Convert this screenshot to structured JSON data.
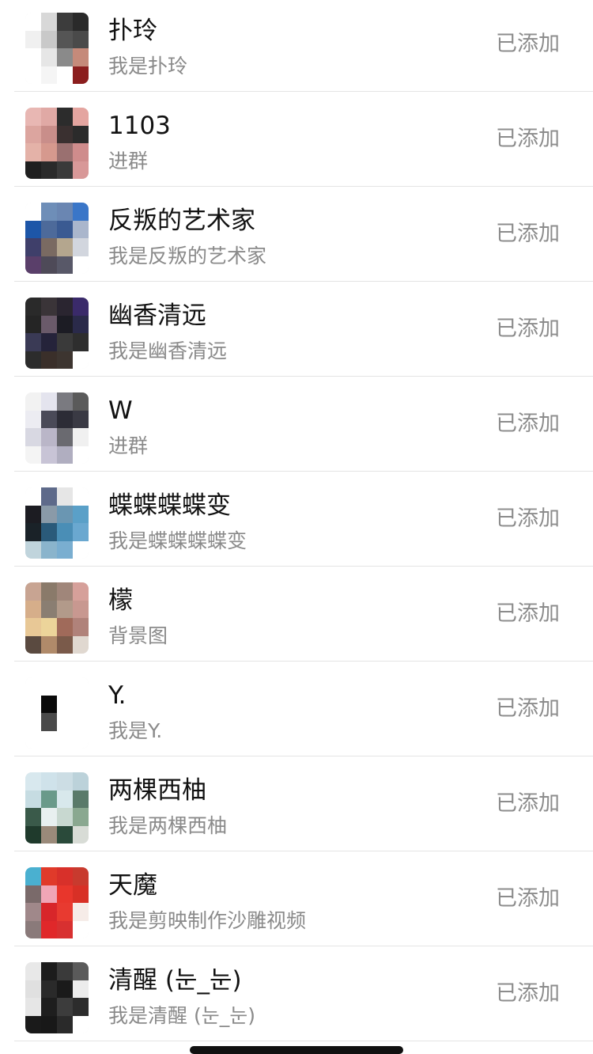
{
  "rows": [
    {
      "name": "扑玲",
      "subtitle": "我是扑玲",
      "status": "已添加",
      "avatar_colors": [
        "#ffffff",
        "#d8d8d8",
        "#3c3c3c",
        "#2a2a2a",
        "#f0f0f0",
        "#c9c9c9",
        "#555555",
        "#4a4a4a",
        "#ffffff",
        "#e6e6e6",
        "#8a8a8a",
        "#c58a7a",
        "#ffffff",
        "#f5f5f5",
        "#ffffff",
        "#8b1e1e"
      ]
    },
    {
      "name": "1103",
      "subtitle": "进群",
      "status": "已添加",
      "avatar_colors": [
        "#e8b7b3",
        "#e0a9a5",
        "#2c2c2c",
        "#e4a5a0",
        "#dca59f",
        "#c98e8a",
        "#3a3030",
        "#2b2b2b",
        "#e4b2a8",
        "#d6998e",
        "#9a7070",
        "#cf8c8c",
        "#1f1f1f",
        "#2a2a2a",
        "#3a3a3a",
        "#d89898"
      ]
    },
    {
      "name": "反叛的艺术家",
      "subtitle": "我是反叛的艺术家",
      "status": "已添加",
      "avatar_colors": [
        "#ffffff",
        "#6e8eb8",
        "#6a86b2",
        "#3a76c8",
        "#1d56a8",
        "#4d6a9a",
        "#3a5a92",
        "#aab6cc",
        "#3f3f6a",
        "#7a6a62",
        "#b4a68e",
        "#d2d6de",
        "#5a3f6a",
        "#4e4a58",
        "#585868",
        "#ffffff"
      ]
    },
    {
      "name": "幽香清远",
      "subtitle": "我是幽香清远",
      "status": "已添加",
      "avatar_colors": [
        "#2a2a2a",
        "#3a3438",
        "#2a2530",
        "#3a2a6a",
        "#252525",
        "#6a5a6a",
        "#1c1c24",
        "#2a2a4a",
        "#3a3a55",
        "#25233a",
        "#3a3a3a",
        "#2e2e2e",
        "#2c2c2c",
        "#3a2f2a",
        "#3d3530",
        "#ffffff"
      ]
    },
    {
      "name": "W",
      "subtitle": "进群",
      "status": "已添加",
      "avatar_colors": [
        "#f2f2f2",
        "#e4e4ee",
        "#7a7a80",
        "#5a5a5a",
        "#ececf2",
        "#4a4a58",
        "#2c2c36",
        "#3a3a44",
        "#d8d8e2",
        "#bab6c8",
        "#6a6a70",
        "#f0f0f0",
        "#f4f4f4",
        "#c8c4d6",
        "#b0aec0",
        "#ffffff"
      ]
    },
    {
      "name": "蝶蝶蝶蝶变",
      "subtitle": "我是蝶蝶蝶蝶变",
      "status": "已添加",
      "avatar_colors": [
        "#ffffff",
        "#5e6a8a",
        "#e6e6e6",
        "#ffffff",
        "#1c1c22",
        "#8a9aa8",
        "#6a96b2",
        "#5aa0c8",
        "#1a2228",
        "#2a5a7a",
        "#4a8eb6",
        "#6aa8d0",
        "#c0d4dc",
        "#8ab4cc",
        "#7aaed0",
        "#ffffff"
      ]
    },
    {
      "name": "檬",
      "subtitle": "背景图",
      "status": "已添加",
      "avatar_colors": [
        "#c8a492",
        "#8a7a6a",
        "#a0867a",
        "#d6a09a",
        "#d6ae8a",
        "#8a7e72",
        "#b29a8a",
        "#c89890",
        "#e8c896",
        "#ecd49a",
        "#a06a5a",
        "#b0827a",
        "#5a4a40",
        "#b08a6a",
        "#7a5a4a",
        "#e0d8d0"
      ]
    },
    {
      "name": "Y.",
      "subtitle": "我是Y.",
      "status": "已添加",
      "avatar_colors": [
        "#ffffff",
        "#ffffff",
        "#ffffff",
        "#ffffff",
        "#ffffff",
        "#0a0a0a",
        "#ffffff",
        "#ffffff",
        "#ffffff",
        "#4a4a4a",
        "#ffffff",
        "#ffffff",
        "#ffffff",
        "#ffffff",
        "#ffffff",
        "#ffffff"
      ]
    },
    {
      "name": "两棵西柚",
      "subtitle": "我是两棵西柚",
      "status": "已添加",
      "avatar_colors": [
        "#d8e8ee",
        "#cfe2ea",
        "#ccdde4",
        "#bcd2da",
        "#c6dce2",
        "#6a9a8a",
        "#d8e8ec",
        "#5a7a6a",
        "#3a5a4a",
        "#e8f0f0",
        "#c8d8d0",
        "#8aa890",
        "#1f3a2c",
        "#9a8a7a",
        "#2a4a3a",
        "#d8dcd6"
      ]
    },
    {
      "name": "天魔",
      "subtitle": "我是剪映制作沙雕视频",
      "status": "已添加",
      "avatar_colors": [
        "#4ab0d0",
        "#e03a2a",
        "#d8302a",
        "#c83a2e",
        "#7a6a6a",
        "#f0a6b6",
        "#e8362c",
        "#d83026",
        "#a0888a",
        "#d8262a",
        "#e83a30",
        "#f6ece8",
        "#8a7a7a",
        "#e0282a",
        "#d83030",
        "#ffffff"
      ]
    },
    {
      "name": "清醒 (눈_눈)",
      "subtitle": "我是清醒 (눈_눈)",
      "status": "已添加",
      "avatar_colors": [
        "#e8e8e8",
        "#1c1c1c",
        "#3a3a3a",
        "#5a5a5a",
        "#e0e0e0",
        "#2a2a2a",
        "#1a1a1a",
        "#ececec",
        "#e6e6e6",
        "#1e1e1e",
        "#3c3c3c",
        "#2c2c2c",
        "#1a1a1a",
        "#181818",
        "#2a2a2a",
        "#ffffff"
      ]
    }
  ]
}
